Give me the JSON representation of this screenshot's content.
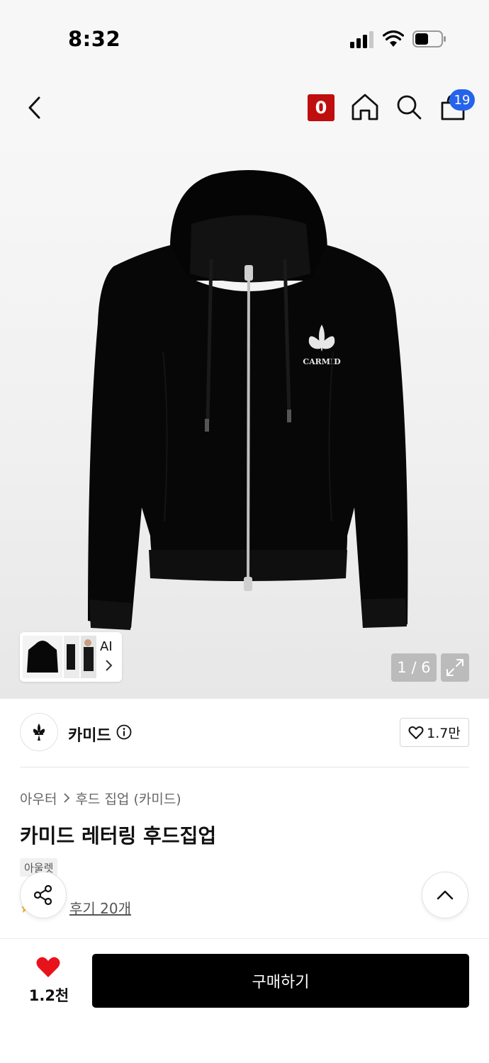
{
  "status_bar": {
    "time": "8:32"
  },
  "header": {
    "brand_badge": "0",
    "cart_count": "19"
  },
  "icons": {
    "back": "chevron-left-icon",
    "home": "home-icon",
    "search": "search-icon",
    "cart": "shopping-bag-icon",
    "share": "share-icon",
    "scroll_top": "chevron-up-icon",
    "expand": "expand-icon",
    "info": "info-icon",
    "heart": "heart-icon"
  },
  "gallery": {
    "ai_label": "AI",
    "page_indicator": "1 / 6",
    "current_index": 1,
    "total": 6,
    "logo_text": "CARMID"
  },
  "brand": {
    "name": "카미드",
    "like_count": "1.7만"
  },
  "breadcrumb": {
    "category": "아우터",
    "subcategory": "후드 집업 (카미드)"
  },
  "product": {
    "title": "카미드 레터링 후드집업",
    "badge": "아울렛",
    "reviews_link": "후기 20개"
  },
  "bottom_bar": {
    "wish_count": "1.2천",
    "buy_label": "구매하기"
  },
  "colors": {
    "accent_red": "#c00d0d",
    "cart_badge_blue": "#2563eb",
    "heart_red": "#e8121c",
    "buy_button": "#000000"
  }
}
